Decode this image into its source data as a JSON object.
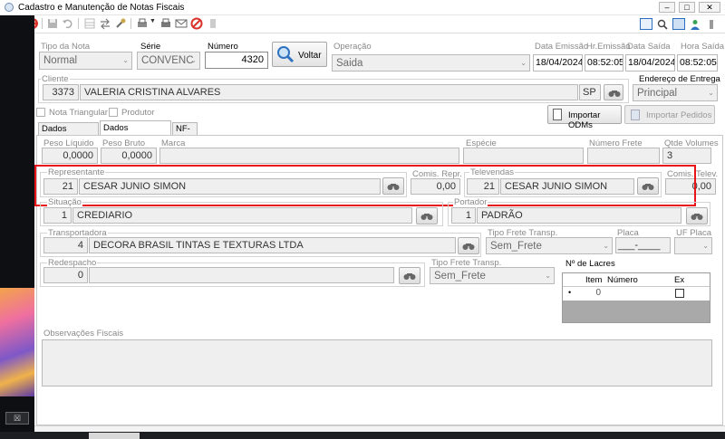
{
  "window": {
    "title": "Cadastro e Manutenção de Notas Fiscais"
  },
  "header": {
    "tipo_nota_label": "Tipo da Nota",
    "tipo_nota_value": "Normal",
    "serie_label": "Série",
    "serie_value": "CONVENC",
    "numero_label": "Número",
    "numero_value": "4320",
    "voltar_label": "Voltar",
    "operacao_label": "Operação",
    "operacao_value": "Saida",
    "data_emissao_label": "Data Emissão",
    "data_emissao_value": "18/04/2024",
    "hr_emissao_label": "Hr.Emissão",
    "hr_emissao_value": "08:52:05",
    "data_saida_label": "Data Saída",
    "data_saida_value": "18/04/2024",
    "hora_saida_label": "Hora Saída",
    "hora_saida_value": "08:52:05"
  },
  "cliente": {
    "label": "Cliente",
    "code": "3373",
    "name": "VALERIA CRISTINA ALVARES",
    "uf": "SP",
    "endereco_label": "Endereço de Entrega",
    "endereco_value": "Principal"
  },
  "options": {
    "nota_triangular": "Nota Triangular",
    "produtor": "Produtor"
  },
  "buttons": {
    "importar_odms": "Importar ODMs",
    "importar_pedidos": "Importar Pedidos"
  },
  "tabs": [
    "Dados Principais",
    "Dados Secundários",
    "NF-e"
  ],
  "secundarios": {
    "peso_liquido_label": "Peso Líquido",
    "peso_liquido_value": "0,0000",
    "peso_bruto_label": "Peso Bruto",
    "peso_bruto_value": "0,0000",
    "marca_label": "Marca",
    "marca_value": "",
    "especie_label": "Espécie",
    "especie_value": "",
    "numero_frete_label": "Número Frete",
    "numero_frete_value": "",
    "qtde_volumes_label": "Qtde Volumes",
    "qtde_volumes_value": "3",
    "representante_label": "Representante",
    "representante_code": "21",
    "representante_name": "CESAR JUNIO SIMON",
    "comis_repr_label": "Comis. Repr.",
    "comis_repr_value": "0,00",
    "televendas_label": "Televendas",
    "televendas_code": "21",
    "televendas_name": "CESAR JUNIO SIMON",
    "comis_telev_label": "Comis. Telev.",
    "comis_telev_value": "0,00",
    "situacao_label": "Situação",
    "situacao_code": "1",
    "situacao_name": "CREDIARIO",
    "portador_label": "Portador",
    "portador_code": "1",
    "portador_name": "PADRÃO",
    "transportadora_label": "Transportadora",
    "transportadora_code": "4",
    "transportadora_name": "DECORA BRASIL TINTAS E TEXTURAS LTDA",
    "tipo_frete_label": "Tipo Frete Transp.",
    "tipo_frete_value": "Sem_Frete",
    "placa_label": "Placa",
    "placa_value": "___-____",
    "uf_placa_label": "UF Placa",
    "uf_placa_value": "",
    "redespacho_label": "Redespacho",
    "redespacho_code": "0",
    "redespacho_name": "",
    "tipo_frete2_label": "Tipo Frete Transp.",
    "tipo_frete2_value": "Sem_Frete",
    "lacres_label": "Nº de Lacres",
    "lacres_headers": [
      "Item",
      "Número",
      "Ex"
    ],
    "lacres_row": {
      "item": "0",
      "numero": ""
    },
    "observacoes_label": "Observações Fiscais"
  },
  "colors": {
    "highlight": "#e8141c",
    "title_bar": "#ffffff",
    "accent": "#2c6fbf"
  }
}
